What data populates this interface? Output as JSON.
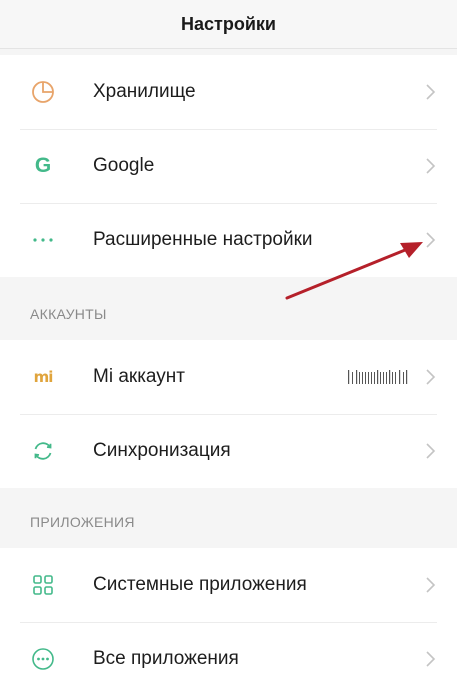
{
  "header": {
    "title": "Настройки"
  },
  "group1": {
    "items": [
      {
        "label": "Хранилище",
        "icon": "storage-pie-icon"
      },
      {
        "label": "Google",
        "icon": "google-g-icon"
      },
      {
        "label": "Расширенные настройки",
        "icon": "more-dots-icon"
      }
    ]
  },
  "accounts": {
    "header": "АККАУНТЫ",
    "items": [
      {
        "label": "Mi аккаунт",
        "icon": "mi-logo-icon",
        "logo_text": "mi"
      },
      {
        "label": "Синхронизация",
        "icon": "sync-icon"
      }
    ]
  },
  "apps": {
    "header": "ПРИЛОЖЕНИЯ",
    "items": [
      {
        "label": "Системные приложения",
        "icon": "system-apps-grid-icon"
      },
      {
        "label": "Все приложения",
        "icon": "all-apps-dots-icon"
      }
    ]
  },
  "colors": {
    "accent_green": "#43b98a",
    "pie_orange": "#e8a46a",
    "mi_orange": "#e0a43c",
    "annotation_arrow": "#b5202a"
  }
}
